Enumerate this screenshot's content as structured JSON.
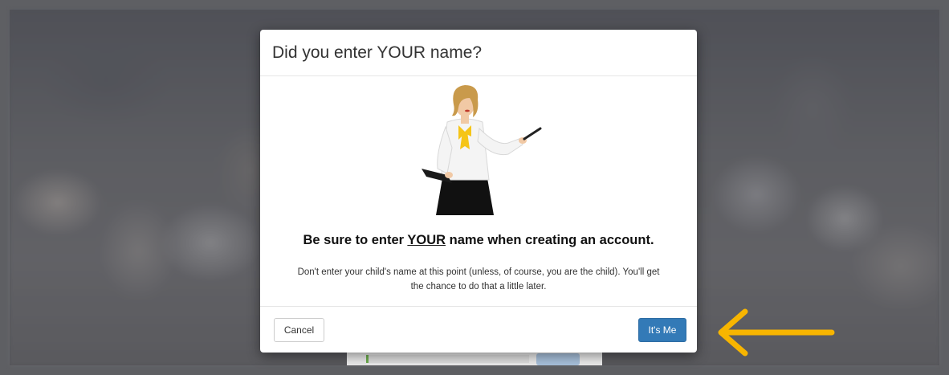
{
  "modal": {
    "title": "Did you enter YOUR name?",
    "headline": {
      "before": "Be sure to enter ",
      "emphasis": "YOUR",
      "after": " name when creating an account."
    },
    "note_line1": "Don't enter your child's name at this point (unless, of course, you are the child). You'll get",
    "note_line2": "the chance to do that a little later.",
    "cancel_label": "Cancel",
    "confirm_label": "It's Me"
  },
  "colors": {
    "primary_button": "#337ab7",
    "arrow": "#f7b500",
    "frame": "#5e5f63"
  },
  "icons": {
    "illustration": "teacher-pointing-illustration",
    "pointer": "arrow-left-icon"
  }
}
